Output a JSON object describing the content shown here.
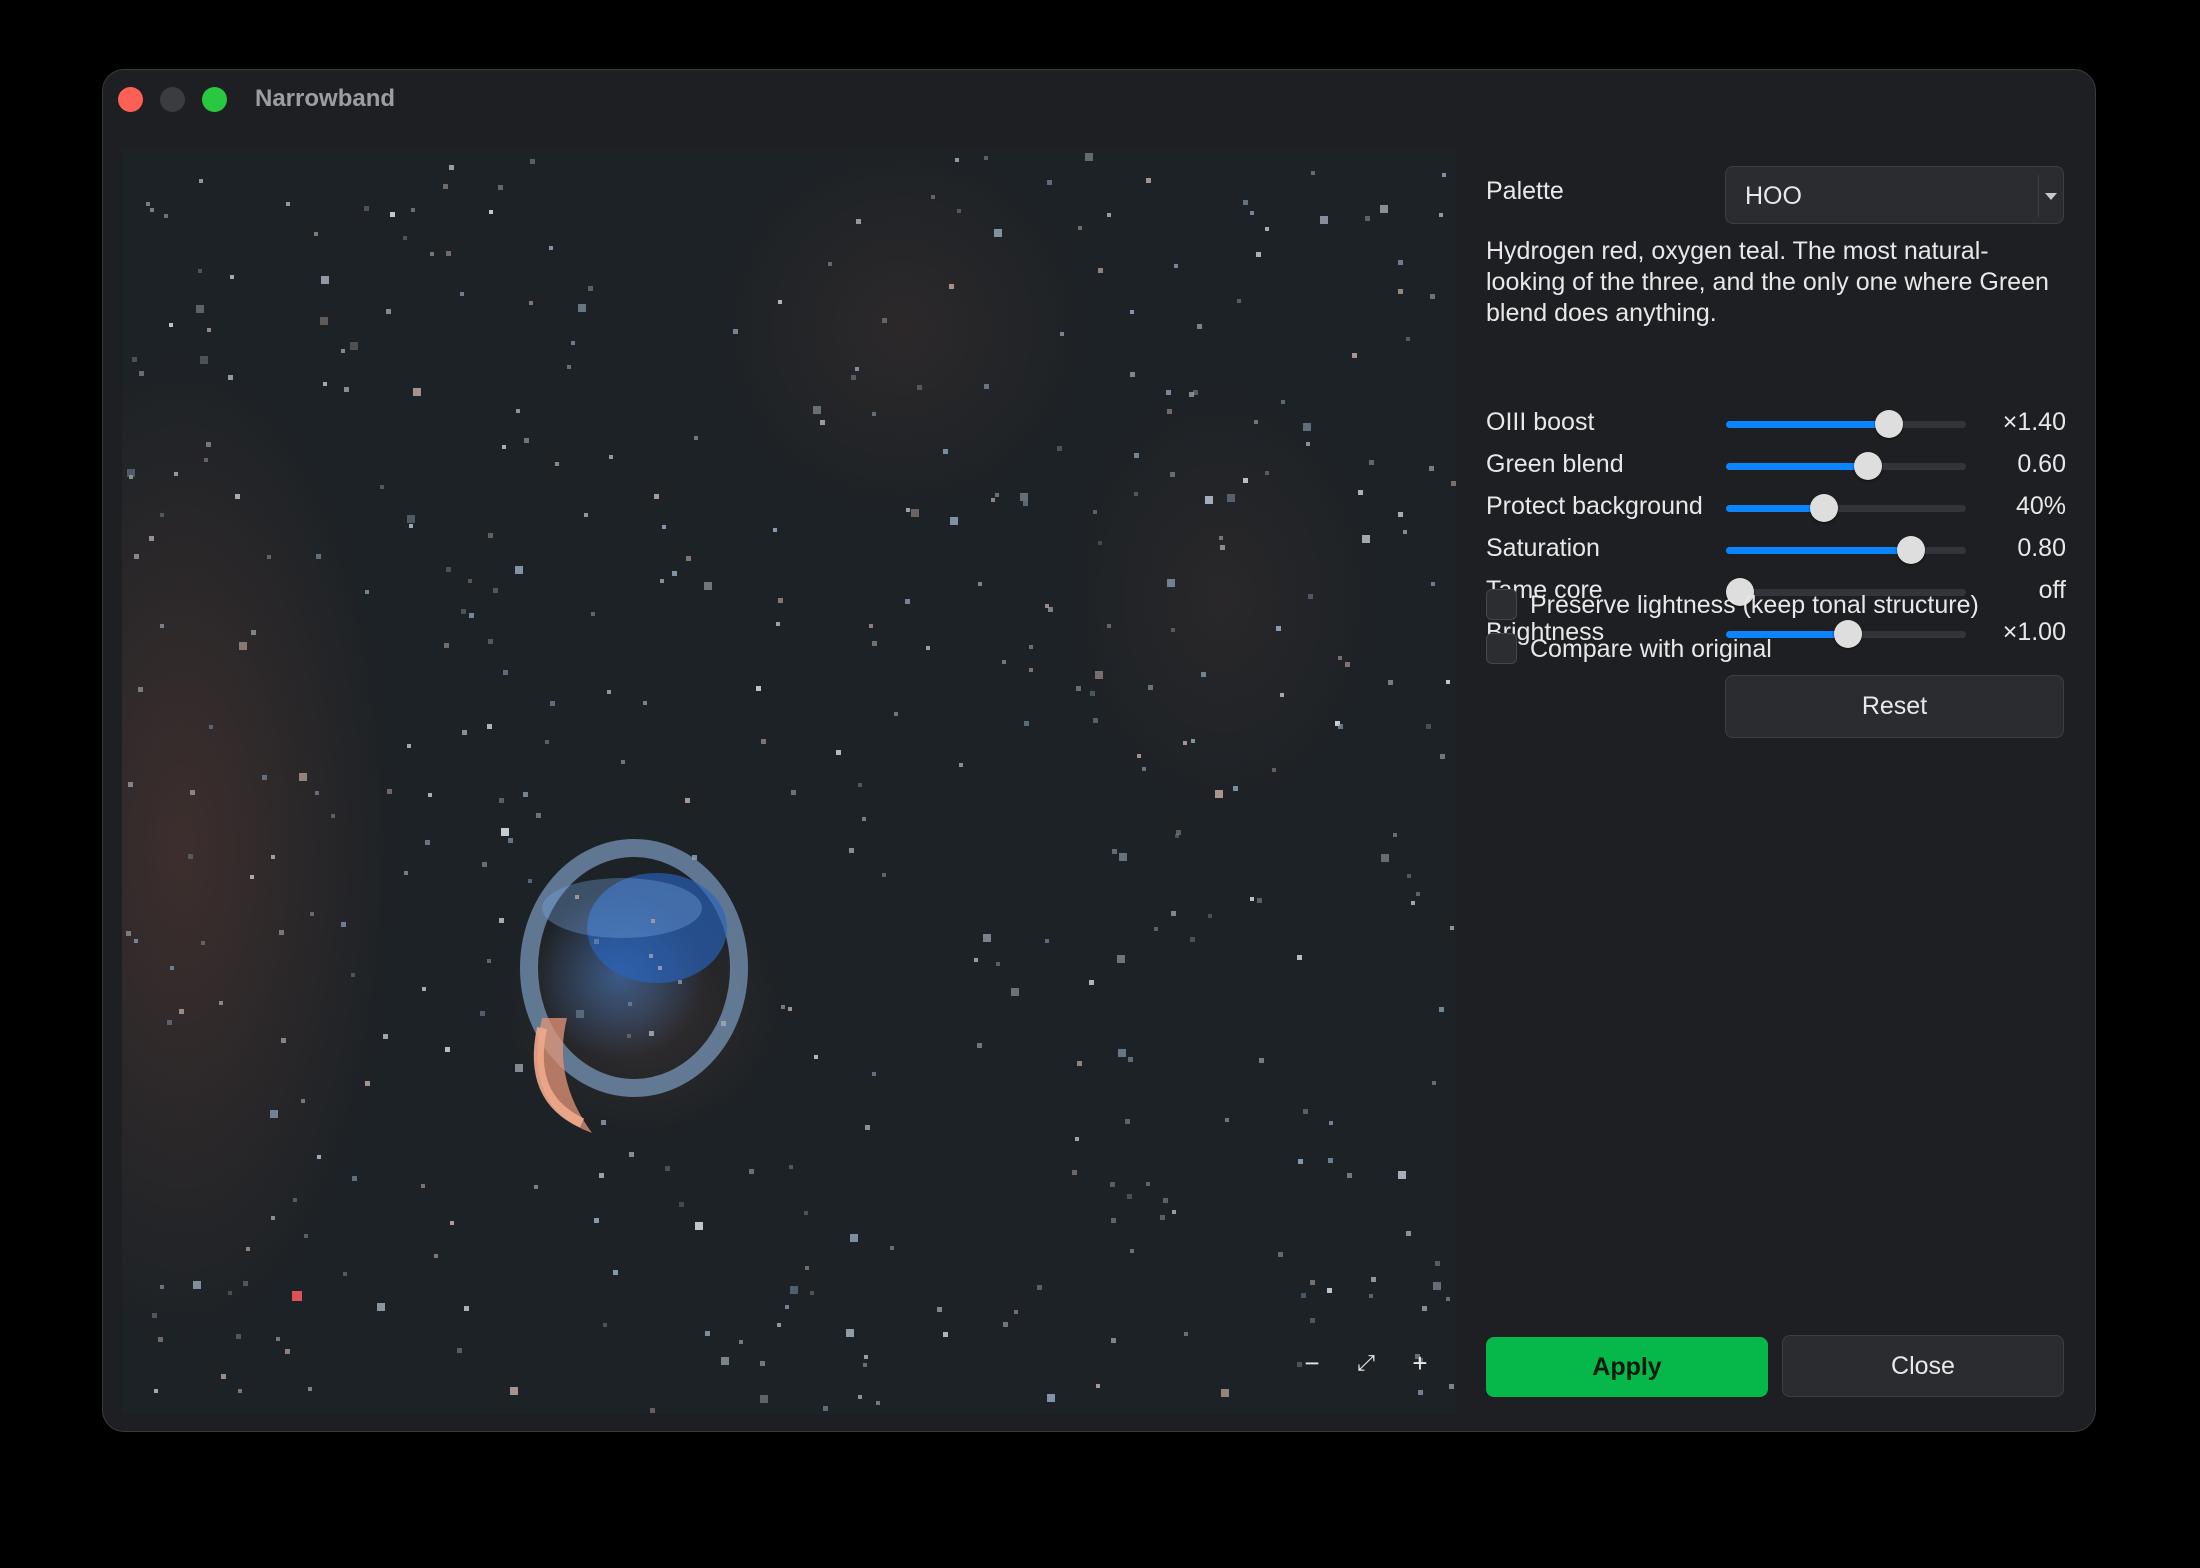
{
  "window": {
    "title": "Narrowband"
  },
  "preview": {
    "zoom_out": "−",
    "fit": "⤢",
    "zoom_in": "+"
  },
  "panel": {
    "palette_label": "Palette",
    "palette_value": "HOO",
    "description": "Hydrogen red, oxygen teal. The most natural-looking of the three, and the only one where Green blend does anything.",
    "sliders": [
      {
        "label": "OIII boost",
        "value": "×1.40",
        "fraction": 0.68
      },
      {
        "label": "Green blend",
        "value": "0.60",
        "fraction": 0.59
      },
      {
        "label": "Protect background",
        "value": "40%",
        "fraction": 0.41
      },
      {
        "label": "Saturation",
        "value": "0.80",
        "fraction": 0.77
      },
      {
        "label": "Tame core",
        "value": "off",
        "fraction": 0.0
      },
      {
        "label": "Brightness",
        "value": "×1.00",
        "fraction": 0.51
      }
    ],
    "checkboxes": [
      {
        "label": "Preserve lightness (keep tonal structure)",
        "checked": false
      },
      {
        "label": "Compare with original",
        "checked": false
      }
    ],
    "reset_label": "Reset",
    "apply_label": "Apply",
    "close_label": "Close"
  },
  "colors": {
    "accent": "#0a84ff",
    "apply": "#06b84a"
  }
}
